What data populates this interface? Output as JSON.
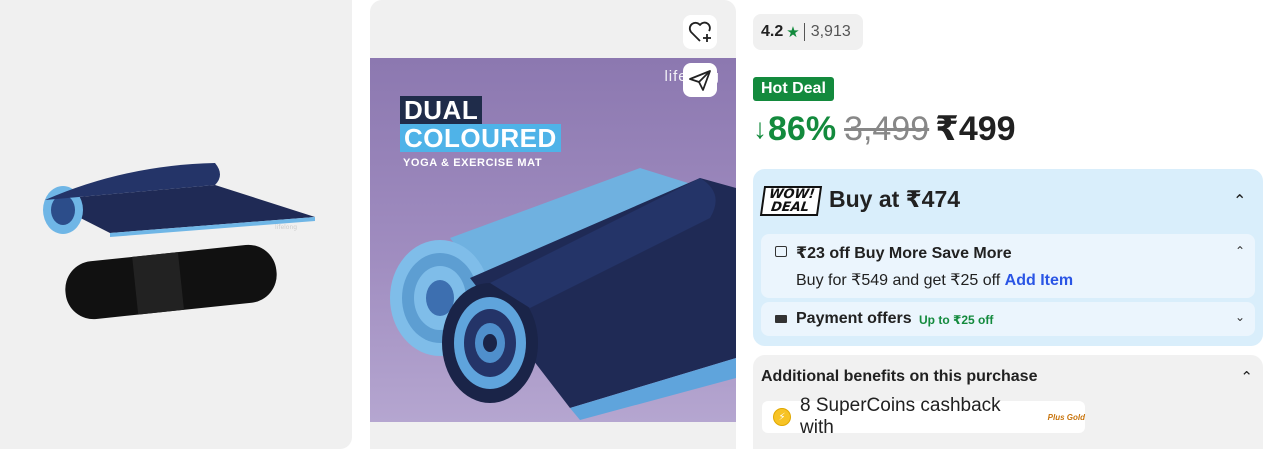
{
  "product_image": {
    "headline_line1": "DUAL",
    "headline_line2": "COLOURED",
    "subheadline": "YOGA & EXERCISE MAT",
    "brand_mark": "lifelong"
  },
  "actions": {
    "wishlist_icon": "heart-plus-icon",
    "share_icon": "share-send-icon"
  },
  "rating": {
    "value": "4.2",
    "star": "★",
    "count": "3,913"
  },
  "deal_badge": "Hot Deal",
  "price": {
    "arrow": "↓",
    "discount": "86%",
    "mrp": "3,499",
    "final": "₹499"
  },
  "wow_deal": {
    "logo_line1": "WOW!",
    "logo_line2": "DEAL",
    "title": "Buy at ₹474",
    "offer": {
      "title": "₹23 off Buy More Save More",
      "desc": "Buy for ₹549 and get ₹25 off",
      "link": "Add Item"
    },
    "payment": {
      "title": "Payment offers",
      "tag": "Up to ₹25 off"
    }
  },
  "benefits": {
    "title": "Additional benefits on this purchase",
    "cashback": "8 SuperCoins cashback with",
    "plus_gold": "Plus Gold"
  },
  "colors": {
    "green": "#138a3d",
    "link_blue": "#2a55e5",
    "wow_bg": "#d9eefb"
  }
}
